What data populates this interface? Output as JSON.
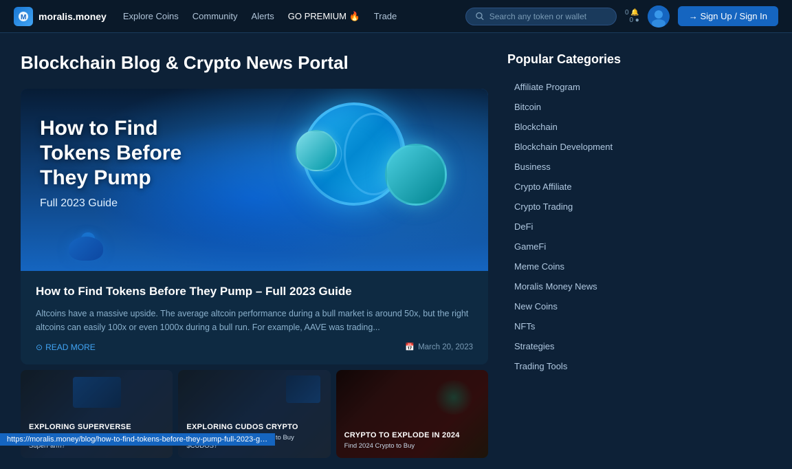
{
  "navbar": {
    "logo_text": "moralis.money",
    "nav_links": [
      {
        "label": "Explore Coins",
        "id": "explore-coins"
      },
      {
        "label": "Community",
        "id": "community"
      },
      {
        "label": "Alerts",
        "id": "alerts"
      },
      {
        "label": "GO PREMIUM 🔥",
        "id": "go-premium"
      },
      {
        "label": "Trade",
        "id": "trade"
      }
    ],
    "search_placeholder": "Search any token or wallet",
    "badges": [
      "0 🔔",
      "0 ●"
    ],
    "sign_up_label": "→ Sign Up / Sign In"
  },
  "page": {
    "title": "Blockchain Blog & Crypto News Portal"
  },
  "featured": {
    "image_title_line1": "How to Find",
    "image_title_line2": "Tokens Before",
    "image_title_line3": "They Pump",
    "image_subtitle": "Full 2023 Guide",
    "post_title": "How to Find Tokens Before They Pump – Full 2023 Guide",
    "excerpt": "Altcoins have a massive upside. The average altcoin performance during a bull market is around 50x, but the right altcoins can easily 100x or even 1000x during a bull run. For example, AAVE was trading...",
    "read_more_label": "READ MORE",
    "date": "March 20, 2023"
  },
  "thumbnails": [
    {
      "id": "thumb-1",
      "title": "EXPLORING SUPERVERSE",
      "subtitle": "What's SuperVerse & What Happened to SuperFarm?"
    },
    {
      "id": "thumb-2",
      "title": "EXPLORING CUDOS CRYPTO",
      "subtitle": "What's CUDOS Crypto & How to Buy $CUDOS?"
    },
    {
      "id": "thumb-3",
      "title": "CRYPTO TO EXPLODE IN 2024",
      "subtitle": "Find 2024 Crypto to Buy"
    }
  ],
  "sidebar": {
    "title": "Popular Categories",
    "categories": [
      "Affiliate Program",
      "Bitcoin",
      "Blockchain",
      "Blockchain Development",
      "Business",
      "Crypto Affiliate",
      "Crypto Trading",
      "DeFi",
      "GameFi",
      "Meme Coins",
      "Moralis Money News",
      "New Coins",
      "NFTs",
      "Strategies",
      "Trading Tools"
    ]
  },
  "status_bar": {
    "url": "https://moralis.money/blog/how-to-find-tokens-before-they-pump-full-2023-guide"
  }
}
